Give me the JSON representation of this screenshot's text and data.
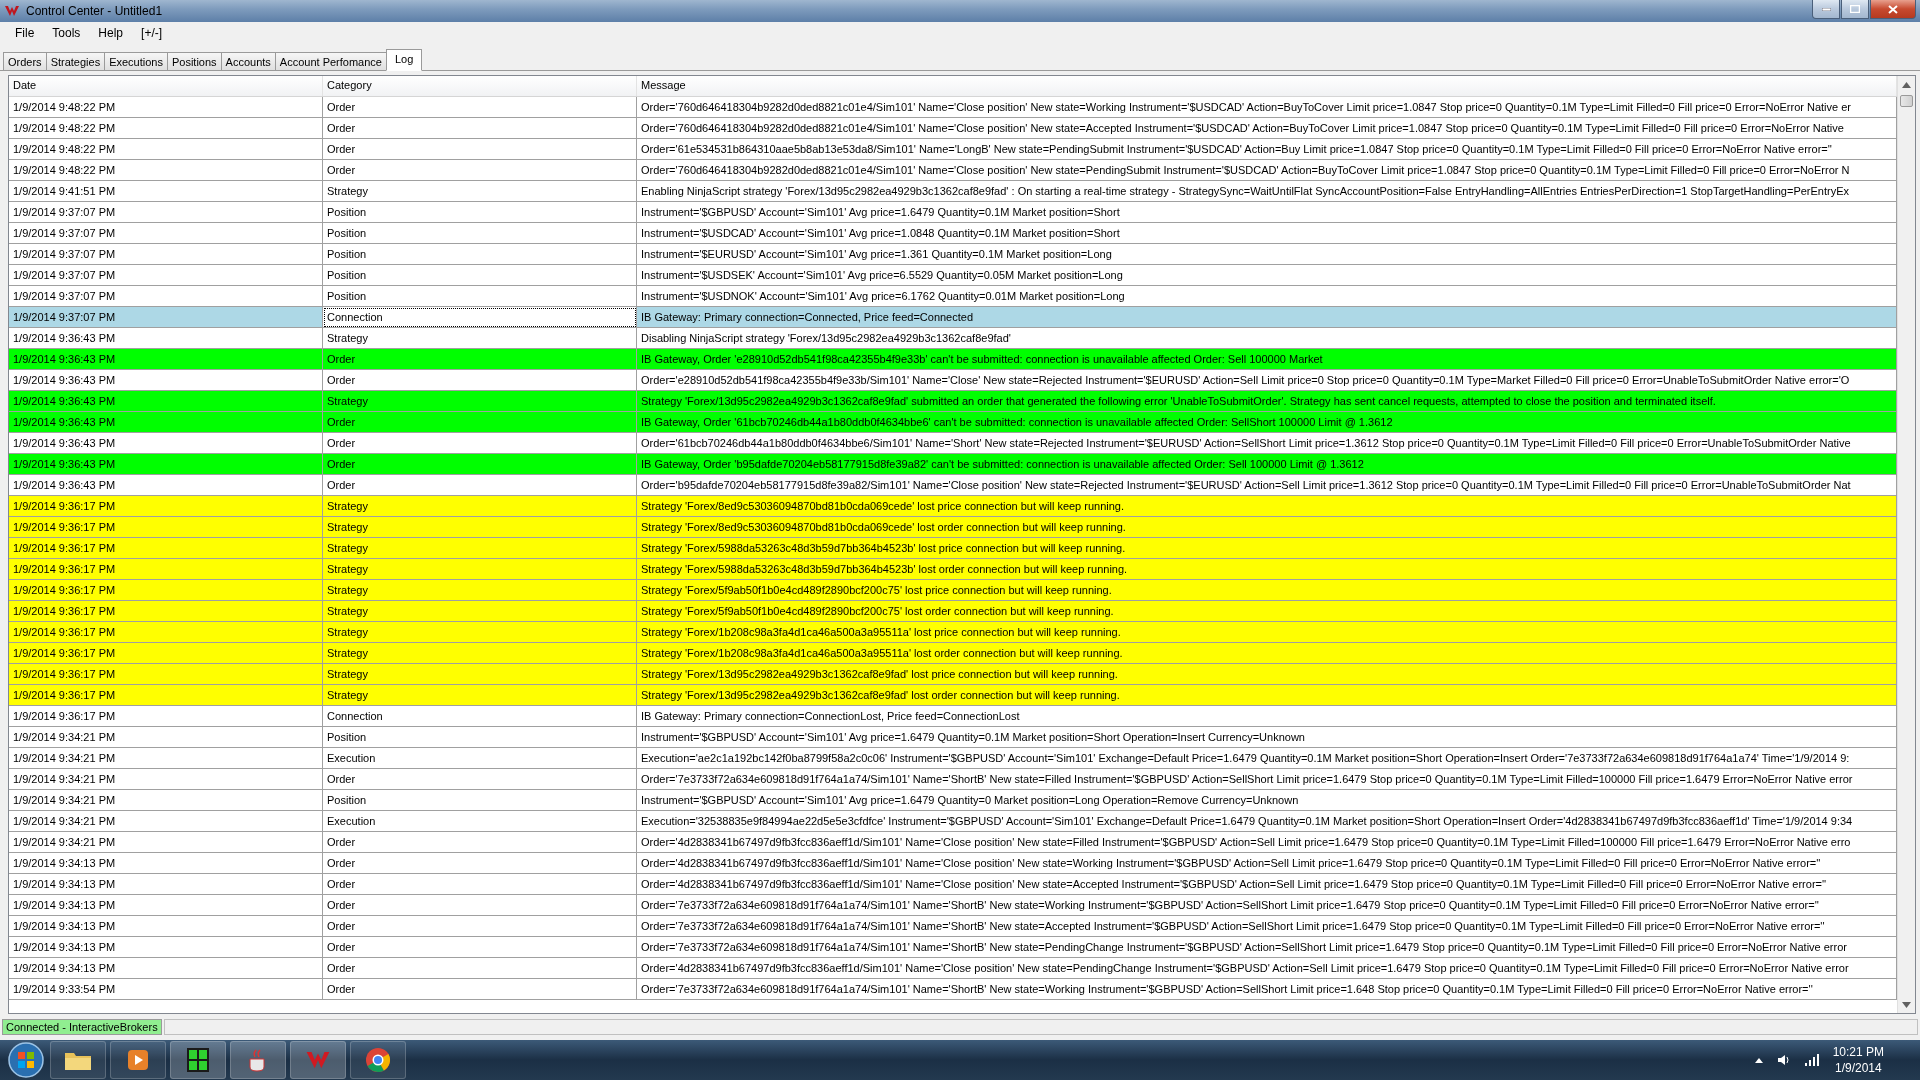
{
  "window": {
    "title": "Control Center - Untitled1"
  },
  "menu": [
    "File",
    "Tools",
    "Help",
    "[+/-]"
  ],
  "tabs": [
    {
      "label": "Orders",
      "selected": false
    },
    {
      "label": "Strategies",
      "selected": false
    },
    {
      "label": "Executions",
      "selected": false
    },
    {
      "label": "Positions",
      "selected": false
    },
    {
      "label": "Accounts",
      "selected": false
    },
    {
      "label": "Account Perfomance",
      "selected": false
    },
    {
      "label": "Log",
      "selected": true
    }
  ],
  "table": {
    "columns": [
      "Date",
      "Category",
      "Message"
    ],
    "rows": [
      {
        "date": "1/9/2014 9:48:22 PM",
        "category": "Order",
        "message": "Order='760d646418304b9282d0ded8821c01e4/Sim101' Name='Close position' New state=Working Instrument='$USDCAD' Action=BuyToCover Limit price=1.0847 Stop price=0 Quantity=0.1M Type=Limit Filled=0 Fill price=0 Error=NoError Native er",
        "color": "#ffffff",
        "selected": false
      },
      {
        "date": "1/9/2014 9:48:22 PM",
        "category": "Order",
        "message": "Order='760d646418304b9282d0ded8821c01e4/Sim101' Name='Close position' New state=Accepted Instrument='$USDCAD' Action=BuyToCover Limit price=1.0847 Stop price=0 Quantity=0.1M Type=Limit Filled=0 Fill price=0 Error=NoError Native",
        "color": "#ffffff",
        "selected": false
      },
      {
        "date": "1/9/2014 9:48:22 PM",
        "category": "Order",
        "message": "Order='61e534531b864310aae5b8ab13e53da8/Sim101' Name='LongB' New state=PendingSubmit Instrument='$USDCAD' Action=Buy Limit price=1.0847 Stop price=0 Quantity=0.1M Type=Limit Filled=0 Fill price=0 Error=NoError Native error=''",
        "color": "#ffffff",
        "selected": false
      },
      {
        "date": "1/9/2014 9:48:22 PM",
        "category": "Order",
        "message": "Order='760d646418304b9282d0ded8821c01e4/Sim101' Name='Close position' New state=PendingSubmit Instrument='$USDCAD' Action=BuyToCover Limit price=1.0847 Stop price=0 Quantity=0.1M Type=Limit Filled=0 Fill price=0 Error=NoError N",
        "color": "#ffffff",
        "selected": false
      },
      {
        "date": "1/9/2014 9:41:51 PM",
        "category": "Strategy",
        "message": "Enabling NinjaScript strategy 'Forex/13d95c2982ea4929b3c1362caf8e9fad' : On starting a real-time strategy - StrategySync=WaitUntilFlat SyncAccountPosition=False EntryHandling=AllEntries EntriesPerDirection=1 StopTargetHandling=PerEntryEx",
        "color": "#ffffff",
        "selected": false
      },
      {
        "date": "1/9/2014 9:37:07 PM",
        "category": "Position",
        "message": "Instrument='$GBPUSD' Account='Sim101' Avg price=1.6479 Quantity=0.1M Market position=Short",
        "color": "#ffffff",
        "selected": false
      },
      {
        "date": "1/9/2014 9:37:07 PM",
        "category": "Position",
        "message": "Instrument='$USDCAD' Account='Sim101' Avg price=1.0848 Quantity=0.1M Market position=Short",
        "color": "#ffffff",
        "selected": false
      },
      {
        "date": "1/9/2014 9:37:07 PM",
        "category": "Position",
        "message": "Instrument='$EURUSD' Account='Sim101' Avg price=1.361 Quantity=0.1M Market position=Long",
        "color": "#ffffff",
        "selected": false
      },
      {
        "date": "1/9/2014 9:37:07 PM",
        "category": "Position",
        "message": "Instrument='$USDSEK' Account='Sim101' Avg price=6.5529 Quantity=0.05M Market position=Long",
        "color": "#ffffff",
        "selected": false
      },
      {
        "date": "1/9/2014 9:37:07 PM",
        "category": "Position",
        "message": "Instrument='$USDNOK' Account='Sim101' Avg price=6.1762 Quantity=0.01M Market position=Long",
        "color": "#ffffff",
        "selected": false
      },
      {
        "date": "1/9/2014 9:37:07 PM",
        "category": "Connection",
        "message": "IB Gateway: Primary connection=Connected, Price feed=Connected",
        "color": "#add8e6",
        "selected": true
      },
      {
        "date": "1/9/2014 9:36:43 PM",
        "category": "Strategy",
        "message": "Disabling NinjaScript strategy 'Forex/13d95c2982ea4929b3c1362caf8e9fad'",
        "color": "#ffffff",
        "selected": false
      },
      {
        "date": "1/9/2014 9:36:43 PM",
        "category": "Order",
        "message": "IB Gateway, Order 'e28910d52db541f98ca42355b4f9e33b' can't be submitted: connection is unavailable affected Order: Sell 100000 Market",
        "color": "#00ff00",
        "selected": false
      },
      {
        "date": "1/9/2014 9:36:43 PM",
        "category": "Order",
        "message": "Order='e28910d52db541f98ca42355b4f9e33b/Sim101' Name='Close' New state=Rejected Instrument='$EURUSD' Action=Sell Limit price=0 Stop price=0 Quantity=0.1M Type=Market Filled=0 Fill price=0 Error=UnableToSubmitOrder Native error='O",
        "color": "#ffffff",
        "selected": false
      },
      {
        "date": "1/9/2014 9:36:43 PM",
        "category": "Strategy",
        "message": "Strategy 'Forex/13d95c2982ea4929b3c1362caf8e9fad' submitted an order that generated the following error 'UnableToSubmitOrder'. Strategy has sent cancel requests, attempted to close the position and terminated itself.",
        "color": "#00ff00",
        "selected": false
      },
      {
        "date": "1/9/2014 9:36:43 PM",
        "category": "Order",
        "message": "IB Gateway, Order '61bcb70246db44a1b80ddb0f4634bbe6' can't be submitted: connection is unavailable affected Order: SellShort 100000 Limit @ 1.3612",
        "color": "#00ff00",
        "selected": false
      },
      {
        "date": "1/9/2014 9:36:43 PM",
        "category": "Order",
        "message": "Order='61bcb70246db44a1b80ddb0f4634bbe6/Sim101' Name='Short' New state=Rejected Instrument='$EURUSD' Action=SellShort Limit price=1.3612 Stop price=0 Quantity=0.1M Type=Limit Filled=0 Fill price=0 Error=UnableToSubmitOrder Native",
        "color": "#ffffff",
        "selected": false
      },
      {
        "date": "1/9/2014 9:36:43 PM",
        "category": "Order",
        "message": "IB Gateway, Order 'b95dafde70204eb58177915d8fe39a82' can't be submitted: connection is unavailable affected Order: Sell 100000 Limit @ 1.3612",
        "color": "#00ff00",
        "selected": false
      },
      {
        "date": "1/9/2014 9:36:43 PM",
        "category": "Order",
        "message": "Order='b95dafde70204eb58177915d8fe39a82/Sim101' Name='Close position' New state=Rejected Instrument='$EURUSD' Action=Sell Limit price=1.3612 Stop price=0 Quantity=0.1M Type=Limit Filled=0 Fill price=0 Error=UnableToSubmitOrder Nat",
        "color": "#ffffff",
        "selected": false
      },
      {
        "date": "1/9/2014 9:36:17 PM",
        "category": "Strategy",
        "message": "Strategy 'Forex/8ed9c53036094870bd81b0cda069cede' lost price connection but will keep running.",
        "color": "#ffff00",
        "selected": false
      },
      {
        "date": "1/9/2014 9:36:17 PM",
        "category": "Strategy",
        "message": "Strategy 'Forex/8ed9c53036094870bd81b0cda069cede' lost order connection but will keep running.",
        "color": "#ffff00",
        "selected": false
      },
      {
        "date": "1/9/2014 9:36:17 PM",
        "category": "Strategy",
        "message": "Strategy 'Forex/5988da53263c48d3b59d7bb364b4523b' lost price connection but will keep running.",
        "color": "#ffff00",
        "selected": false
      },
      {
        "date": "1/9/2014 9:36:17 PM",
        "category": "Strategy",
        "message": "Strategy 'Forex/5988da53263c48d3b59d7bb364b4523b' lost order connection but will keep running.",
        "color": "#ffff00",
        "selected": false
      },
      {
        "date": "1/9/2014 9:36:17 PM",
        "category": "Strategy",
        "message": "Strategy 'Forex/5f9ab50f1b0e4cd489f2890bcf200c75' lost price connection but will keep running.",
        "color": "#ffff00",
        "selected": false
      },
      {
        "date": "1/9/2014 9:36:17 PM",
        "category": "Strategy",
        "message": "Strategy 'Forex/5f9ab50f1b0e4cd489f2890bcf200c75' lost order connection but will keep running.",
        "color": "#ffff00",
        "selected": false
      },
      {
        "date": "1/9/2014 9:36:17 PM",
        "category": "Strategy",
        "message": "Strategy 'Forex/1b208c98a3fa4d1ca46a500a3a95511a' lost price connection but will keep running.",
        "color": "#ffff00",
        "selected": false
      },
      {
        "date": "1/9/2014 9:36:17 PM",
        "category": "Strategy",
        "message": "Strategy 'Forex/1b208c98a3fa4d1ca46a500a3a95511a' lost order connection but will keep running.",
        "color": "#ffff00",
        "selected": false
      },
      {
        "date": "1/9/2014 9:36:17 PM",
        "category": "Strategy",
        "message": "Strategy 'Forex/13d95c2982ea4929b3c1362caf8e9fad' lost price connection but will keep running.",
        "color": "#ffff00",
        "selected": false
      },
      {
        "date": "1/9/2014 9:36:17 PM",
        "category": "Strategy",
        "message": "Strategy 'Forex/13d95c2982ea4929b3c1362caf8e9fad' lost order connection but will keep running.",
        "color": "#ffff00",
        "selected": false
      },
      {
        "date": "1/9/2014 9:36:17 PM",
        "category": "Connection",
        "message": "IB Gateway: Primary connection=ConnectionLost, Price feed=ConnectionLost",
        "color": "#ffffff",
        "selected": false
      },
      {
        "date": "1/9/2014 9:34:21 PM",
        "category": "Position",
        "message": "Instrument='$GBPUSD' Account='Sim101' Avg price=1.6479 Quantity=0.1M Market position=Short Operation=Insert Currency=Unknown",
        "color": "#ffffff",
        "selected": false
      },
      {
        "date": "1/9/2014 9:34:21 PM",
        "category": "Execution",
        "message": "Execution='ae2c1a192bc142f0ba8799f58a2c0c06' Instrument='$GBPUSD' Account='Sim101' Exchange=Default Price=1.6479 Quantity=0.1M Market position=Short Operation=Insert Order='7e3733f72a634e609818d91f764a1a74' Time='1/9/2014 9:",
        "color": "#ffffff",
        "selected": false
      },
      {
        "date": "1/9/2014 9:34:21 PM",
        "category": "Order",
        "message": "Order='7e3733f72a634e609818d91f764a1a74/Sim101' Name='ShortB' New state=Filled Instrument='$GBPUSD' Action=SellShort Limit price=1.6479 Stop price=0 Quantity=0.1M Type=Limit Filled=100000 Fill price=1.6479 Error=NoError Native error",
        "color": "#ffffff",
        "selected": false
      },
      {
        "date": "1/9/2014 9:34:21 PM",
        "category": "Position",
        "message": "Instrument='$GBPUSD' Account='Sim101' Avg price=1.6479 Quantity=0 Market position=Long Operation=Remove Currency=Unknown",
        "color": "#ffffff",
        "selected": false
      },
      {
        "date": "1/9/2014 9:34:21 PM",
        "category": "Execution",
        "message": "Execution='32538835e9f84994ae22d5e5e3cfdfce' Instrument='$GBPUSD' Account='Sim101' Exchange=Default Price=1.6479 Quantity=0.1M Market position=Short Operation=Insert Order='4d2838341b67497d9fb3fcc836aeff1d' Time='1/9/2014 9:34",
        "color": "#ffffff",
        "selected": false
      },
      {
        "date": "1/9/2014 9:34:21 PM",
        "category": "Order",
        "message": "Order='4d2838341b67497d9fb3fcc836aeff1d/Sim101' Name='Close position' New state=Filled Instrument='$GBPUSD' Action=Sell Limit price=1.6479 Stop price=0 Quantity=0.1M Type=Limit Filled=100000 Fill price=1.6479 Error=NoError Native erro",
        "color": "#ffffff",
        "selected": false
      },
      {
        "date": "1/9/2014 9:34:13 PM",
        "category": "Order",
        "message": "Order='4d2838341b67497d9fb3fcc836aeff1d/Sim101' Name='Close position' New state=Working Instrument='$GBPUSD' Action=Sell Limit price=1.6479 Stop price=0 Quantity=0.1M Type=Limit Filled=0 Fill price=0 Error=NoError Native error=''",
        "color": "#ffffff",
        "selected": false
      },
      {
        "date": "1/9/2014 9:34:13 PM",
        "category": "Order",
        "message": "Order='4d2838341b67497d9fb3fcc836aeff1d/Sim101' Name='Close position' New state=Accepted Instrument='$GBPUSD' Action=Sell Limit price=1.6479 Stop price=0 Quantity=0.1M Type=Limit Filled=0 Fill price=0 Error=NoError Native error=''",
        "color": "#ffffff",
        "selected": false
      },
      {
        "date": "1/9/2014 9:34:13 PM",
        "category": "Order",
        "message": "Order='7e3733f72a634e609818d91f764a1a74/Sim101' Name='ShortB' New state=Working Instrument='$GBPUSD' Action=SellShort Limit price=1.6479 Stop price=0 Quantity=0.1M Type=Limit Filled=0 Fill price=0 Error=NoError Native error=''",
        "color": "#ffffff",
        "selected": false
      },
      {
        "date": "1/9/2014 9:34:13 PM",
        "category": "Order",
        "message": "Order='7e3733f72a634e609818d91f764a1a74/Sim101' Name='ShortB' New state=Accepted Instrument='$GBPUSD' Action=SellShort Limit price=1.6479 Stop price=0 Quantity=0.1M Type=Limit Filled=0 Fill price=0 Error=NoError Native error=''",
        "color": "#ffffff",
        "selected": false
      },
      {
        "date": "1/9/2014 9:34:13 PM",
        "category": "Order",
        "message": "Order='7e3733f72a634e609818d91f764a1a74/Sim101' Name='ShortB' New state=PendingChange Instrument='$GBPUSD' Action=SellShort Limit price=1.6479 Stop price=0 Quantity=0.1M Type=Limit Filled=0 Fill price=0 Error=NoError Native error",
        "color": "#ffffff",
        "selected": false
      },
      {
        "date": "1/9/2014 9:34:13 PM",
        "category": "Order",
        "message": "Order='4d2838341b67497d9fb3fcc836aeff1d/Sim101' Name='Close position' New state=PendingChange Instrument='$GBPUSD' Action=Sell Limit price=1.6479 Stop price=0 Quantity=0.1M Type=Limit Filled=0 Fill price=0 Error=NoError Native error",
        "color": "#ffffff",
        "selected": false
      },
      {
        "date": "1/9/2014 9:33:54 PM",
        "category": "Order",
        "message": "Order='7e3733f72a634e609818d91f764a1a74/Sim101' Name='ShortB' New state=Working Instrument='$GBPUSD' Action=SellShort Limit price=1.648 Stop price=0 Quantity=0.1M Type=Limit Filled=0 Fill price=0 Error=NoError Native error=''",
        "color": "#ffffff",
        "selected": false
      }
    ]
  },
  "status_bar": {
    "text": "Connected - InteractiveBrokers"
  },
  "taskbar": {
    "time": "10:21 PM",
    "date": "1/9/2014"
  }
}
